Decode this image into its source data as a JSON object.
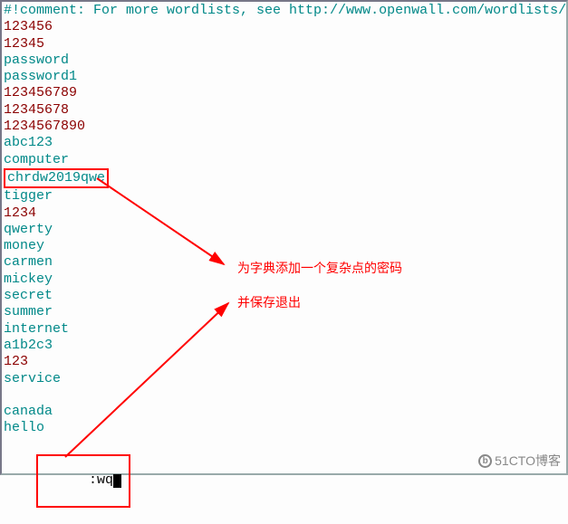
{
  "comment": "#!comment: For more wordlists, see http://www.openwall.com/wordlists/",
  "lines": {
    "l0": "123456",
    "l1": "12345",
    "l2": "password",
    "l3": "password1",
    "l4": "123456789",
    "l5": "12345678",
    "l6": "1234567890",
    "l7": "abc123",
    "l8": "computer",
    "l9": "chrdw2019qwe",
    "l10": "tigger",
    "l11": "1234",
    "l12": "qwerty",
    "l13": "money",
    "l14": "carmen",
    "l15": "mickey",
    "l16": "secret",
    "l17": "summer",
    "l18": "internet",
    "l19": "a1b2c3",
    "l20": "123",
    "l21": "service",
    "blank": " ",
    "l22": "canada",
    "l23": "hello"
  },
  "command": ":wq",
  "annotation1": "为字典添加一个复杂点的密码",
  "annotation2": "并保存退出",
  "watermark": "51CTO博客"
}
